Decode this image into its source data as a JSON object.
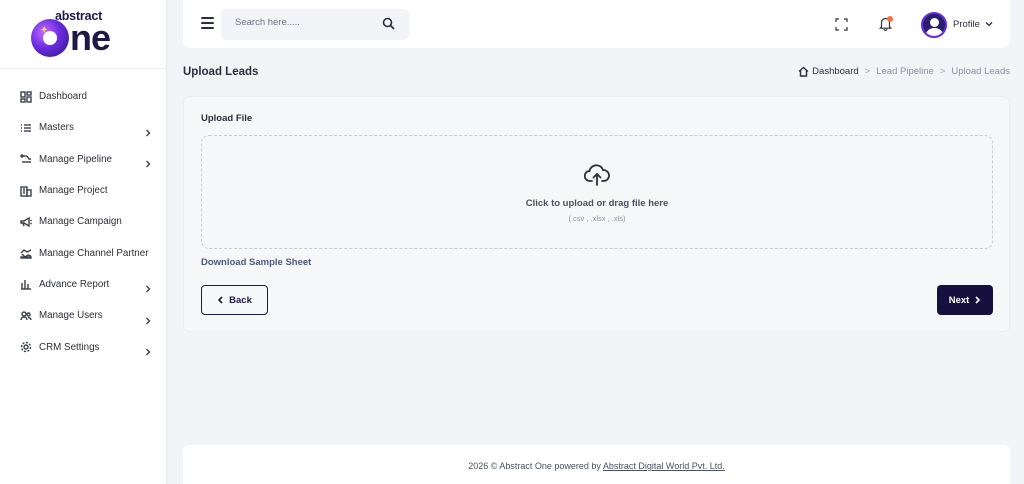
{
  "brand": {
    "top": "abstract",
    "main_o": "O",
    "main_rest": "ne"
  },
  "sidebar": {
    "items": [
      {
        "label": "Dashboard",
        "icon": "dashboard-icon",
        "has_submenu": false
      },
      {
        "label": "Masters",
        "icon": "list-icon",
        "has_submenu": true
      },
      {
        "label": "Manage Pipeline",
        "icon": "pipeline-icon",
        "has_submenu": true
      },
      {
        "label": "Manage Project",
        "icon": "building-icon",
        "has_submenu": false
      },
      {
        "label": "Manage Campaign",
        "icon": "megaphone-icon",
        "has_submenu": false
      },
      {
        "label": "Manage Channel Partner",
        "icon": "handshake-icon",
        "has_submenu": false
      },
      {
        "label": "Advance Report",
        "icon": "bar-chart-icon",
        "has_submenu": true
      },
      {
        "label": "Manage Users",
        "icon": "users-icon",
        "has_submenu": true
      },
      {
        "label": "CRM Settings",
        "icon": "gear-icon",
        "has_submenu": true
      }
    ]
  },
  "header": {
    "search_placeholder": "Search here.....",
    "profile_label": "Profile"
  },
  "page": {
    "title": "Upload Leads",
    "breadcrumb": [
      "Dashboard",
      "Lead Pipeline",
      "Upload Leads"
    ],
    "breadcrumb_sep": ">"
  },
  "upload": {
    "label": "Upload File",
    "drop_text": "Click to upload or drag file here",
    "formats": "(.csv , .xlsx , .xls)",
    "sample_link": "Download Sample Sheet",
    "back_label": "Back",
    "next_label": "Next"
  },
  "footer": {
    "text": "2026 © Abstract One powered by ",
    "link": "Abstract Digital World Pvt. Ltd."
  },
  "colors": {
    "primary": "#17103f",
    "accent": "#6a2be0",
    "notification_dot": "#ff6b35",
    "background": "#f3f4f7"
  }
}
